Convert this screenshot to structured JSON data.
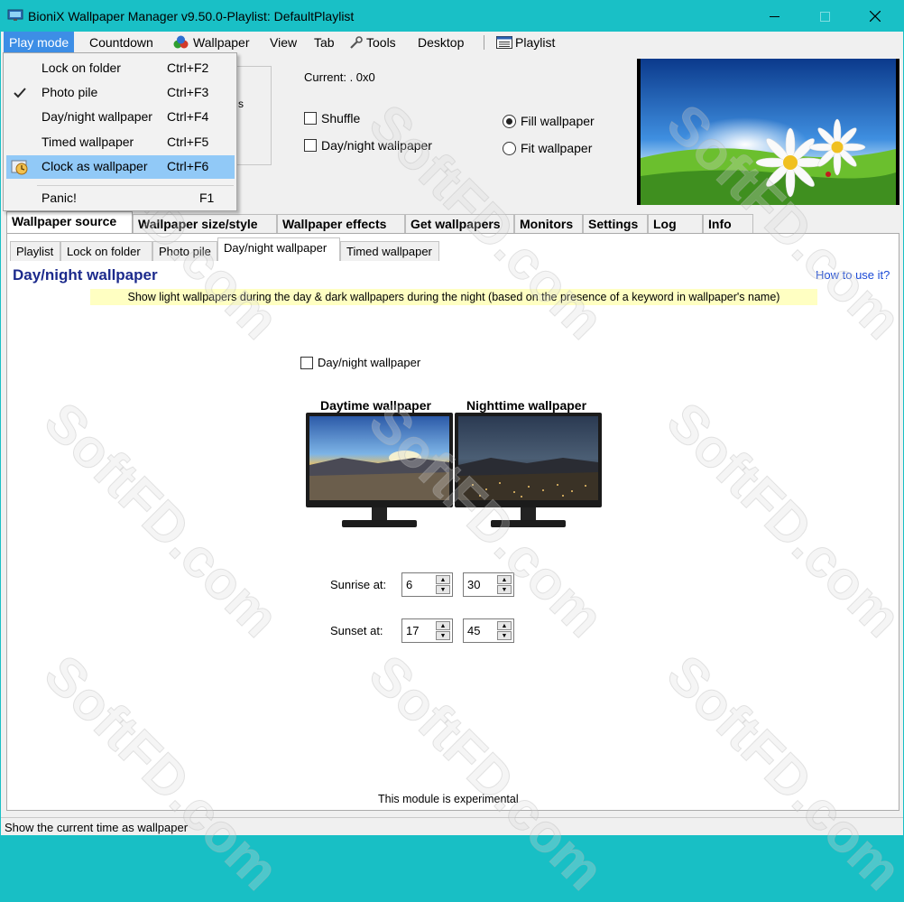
{
  "window": {
    "title": "BioniX Wallpaper Manager  v9.50.0-Playlist: DefaultPlaylist",
    "icon": "monitor-app-icon"
  },
  "menubar": {
    "items": [
      "Play mode",
      "Countdown",
      "Wallpaper",
      "View",
      "Tab",
      "Tools",
      "Desktop",
      "Playlist"
    ]
  },
  "play_mode_menu": {
    "items": [
      {
        "label": "Lock on folder",
        "shortcut": "Ctrl+F2"
      },
      {
        "label": "Photo pile",
        "shortcut": "Ctrl+F3",
        "checked": true
      },
      {
        "label": "Day/night wallpaper",
        "shortcut": "Ctrl+F4"
      },
      {
        "label": "Timed wallpaper",
        "shortcut": "Ctrl+F5"
      },
      {
        "label": "Clock as wallpaper",
        "shortcut": "Ctrl+F6",
        "highlighted": true,
        "icon": "clock-icon"
      },
      {
        "label": "Panic!",
        "shortcut": "F1"
      }
    ]
  },
  "top_panel": {
    "partial_text": "s",
    "current_label": "Current: .  0x0",
    "shuffle_label": "Shuffle",
    "shuffle_checked": false,
    "daynight_label": "Day/night wallpaper",
    "daynight_checked": false,
    "fill_label": "Fill wallpaper",
    "fit_label": "Fit wallpaper",
    "selected_fit_mode": "Fill wallpaper"
  },
  "main_tabs": [
    "Wallpaper source",
    "Wallpaper size/style",
    "Wallpaper effects",
    "Get wallpapers",
    "Monitors",
    "Settings",
    "Log",
    "Info"
  ],
  "main_tab_selected": "Wallpaper source",
  "sub_tabs": [
    "Playlist",
    "Lock on folder",
    "Photo pile",
    "Day/night wallpaper",
    "Timed wallpaper"
  ],
  "sub_tab_selected": "Day/night wallpaper",
  "daynight_page": {
    "heading": "Day/night wallpaper",
    "how_to": "How to use it?",
    "hint": "Show light wallpapers during the day & dark wallpapers during the night (based on the presence of a keyword in wallpaper's name)",
    "enable_label": "Day/night wallpaper",
    "enable_checked": false,
    "daytime_label": "Daytime wallpaper",
    "nighttime_label": "Nighttime wallpaper",
    "sunrise_label": "Sunrise at:",
    "sunrise_hour": "6",
    "sunrise_minute": "30",
    "sunset_label": "Sunset at:",
    "sunset_hour": "17",
    "sunset_minute": "45",
    "footer": "This module is experimental"
  },
  "statusbar": {
    "text": "Show the current time as wallpaper"
  },
  "watermark": "SoftFD.com",
  "colors": {
    "titlebar": "#19c0c6",
    "menu_active": "#3d8ee6",
    "menu_highlight": "#91c9f7",
    "heading": "#1c2a8c",
    "link": "#1a49d6",
    "hint_bg": "#ffffc2"
  }
}
